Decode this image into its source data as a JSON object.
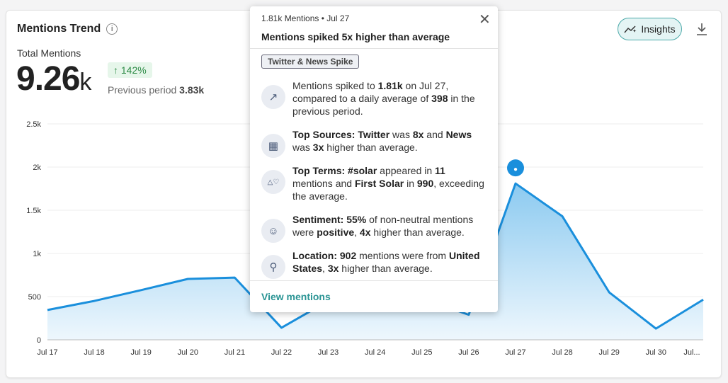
{
  "header": {
    "title": "Mentions Trend",
    "total_label": "Total Mentions",
    "total_value": "9.26",
    "total_unit": "k",
    "change": "142%",
    "previous_label": "Previous period",
    "previous_value": "3.83k",
    "insights_label": "Insights"
  },
  "tooltip": {
    "header": "1.81k Mentions • Jul 27",
    "title": "Mentions spiked 5x higher than average",
    "tag": "Twitter & News Spike",
    "view_link": "View mentions",
    "items": [
      {
        "icon": "trend-up-icon",
        "html": "Mentions spiked to <b>1.81k</b> on Jul 27, compared to a daily average of <b>398</b> in the previous period."
      },
      {
        "icon": "building-icon",
        "html": "<b>Top Sources: Twitter</b> was <b>8x</b> and <b>News</b> was <b>3x</b> higher than average."
      },
      {
        "icon": "shapes-icon",
        "html": "<b>Top Terms: #solar</b> appeared in <b>11</b> mentions and <b>First Solar</b> in <b>990</b>, exceeding the average."
      },
      {
        "icon": "smile-icon",
        "html": "<b>Sentiment: 55%</b> of non-neutral mentions were <b>positive</b>, <b>4x</b> higher than average."
      },
      {
        "icon": "location-pin-icon",
        "html": "<b>Location: 902</b> mentions were from <b>United States</b>, <b>3x</b> higher than average."
      }
    ]
  },
  "chart_data": {
    "type": "area",
    "categories": [
      "Jul 17",
      "Jul 18",
      "Jul 19",
      "Jul 20",
      "Jul 21",
      "Jul 22",
      "Jul 23",
      "Jul 24",
      "Jul 25",
      "Jul 26",
      "Jul 27",
      "Jul 28",
      "Jul 29",
      "Jul 30",
      "Jul..."
    ],
    "values": [
      345,
      450,
      575,
      705,
      720,
      140,
      450,
      520,
      480,
      290,
      1810,
      1430,
      550,
      130,
      465
    ],
    "yticks": [
      "0",
      "500",
      "1k",
      "1.5k",
      "2k",
      "2.5k"
    ],
    "ylim": [
      0,
      2500
    ],
    "grid": true,
    "color": "#1a8fdc",
    "highlight": "Jul 27"
  }
}
